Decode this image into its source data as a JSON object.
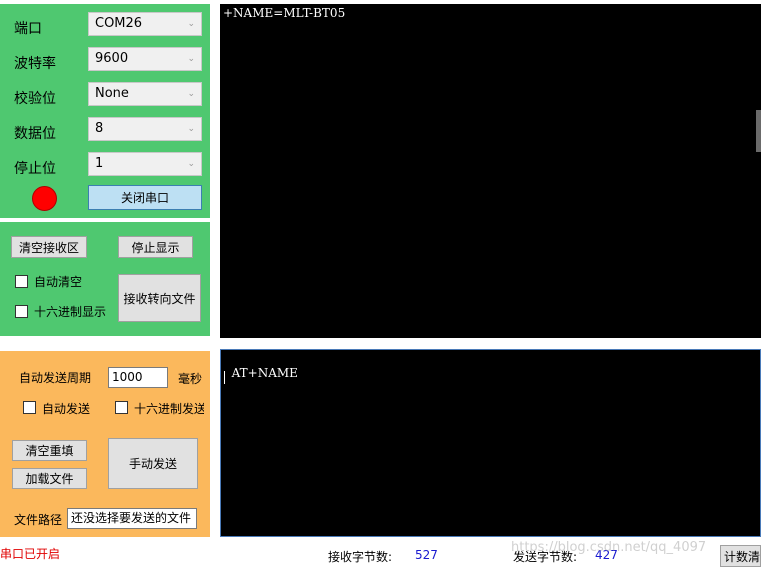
{
  "serial": {
    "port_label": "端口",
    "port_value": "COM26",
    "baud_label": "波特率",
    "baud_value": "9600",
    "parity_label": "校验位",
    "parity_value": "None",
    "databits_label": "数据位",
    "databits_value": "8",
    "stopbits_label": "停止位",
    "stopbits_value": "1",
    "status_color": "#ff0000",
    "close_port_button": "关闭串口"
  },
  "receive": {
    "clear_button": "清空接收区",
    "stop_display_button": "停止显示",
    "auto_clear_label": "自动清空",
    "hex_display_label": "十六进制显示",
    "to_file_button": "接收转向文件",
    "terminal_text": "+NAME=MLT-BT05"
  },
  "send": {
    "period_label": "自动发送周期",
    "period_value": "1000",
    "period_unit": "毫秒",
    "auto_send_label": "自动发送",
    "hex_send_label": "十六进制发送",
    "clear_refill_button": "清空重填",
    "load_file_button": "加载文件",
    "manual_send_button": "手动发送",
    "file_path_label": "文件路径",
    "file_path_value": "还没选择要发送的文件",
    "terminal_text": "AT+NAME"
  },
  "statusbar": {
    "port_status": "串口已开启",
    "rx_label": "接收字节数:",
    "rx_value": "527",
    "tx_label": "发送字节数:",
    "tx_value": "427",
    "reset_button": "计数清零",
    "watermark": "https://blog.csdn.net/qq_4097"
  },
  "colors": {
    "green_panel": "#4fc870",
    "orange_panel": "#fbb85c",
    "status_text": "#e00000",
    "count_text": "#1a1ad0"
  }
}
